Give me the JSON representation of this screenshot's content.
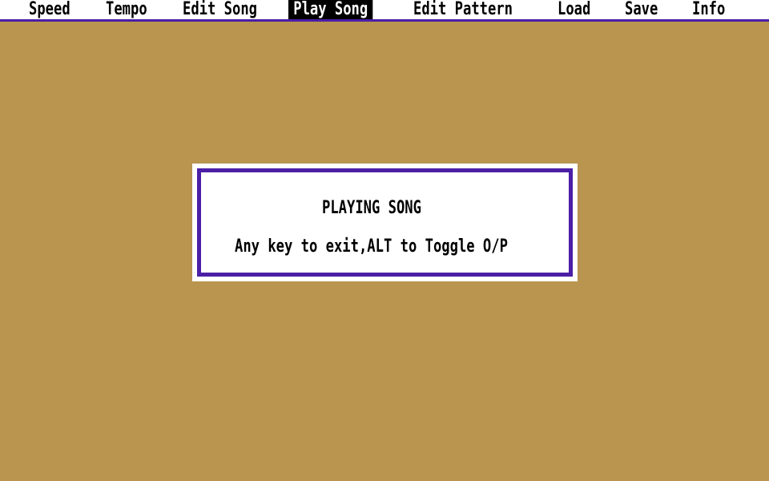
{
  "menubar": {
    "items": [
      {
        "label": "Speed",
        "active": false
      },
      {
        "label": "Tempo",
        "active": false
      },
      {
        "label": "Edit Song",
        "active": false
      },
      {
        "label": "Play Song",
        "active": true
      },
      {
        "label": "Edit Pattern",
        "active": false
      },
      {
        "label": "Load",
        "active": false
      },
      {
        "label": "Save",
        "active": false
      },
      {
        "label": "Info",
        "active": false
      }
    ]
  },
  "dialog": {
    "title": "PLAYING SONG",
    "message": "Any key to exit,ALT to Toggle O/P"
  },
  "colors": {
    "desktop": "#b9954f",
    "accent": "#4b1fa6",
    "menubar_bg": "#ffffff",
    "active_bg": "#000000",
    "active_text": "#ffffff"
  }
}
